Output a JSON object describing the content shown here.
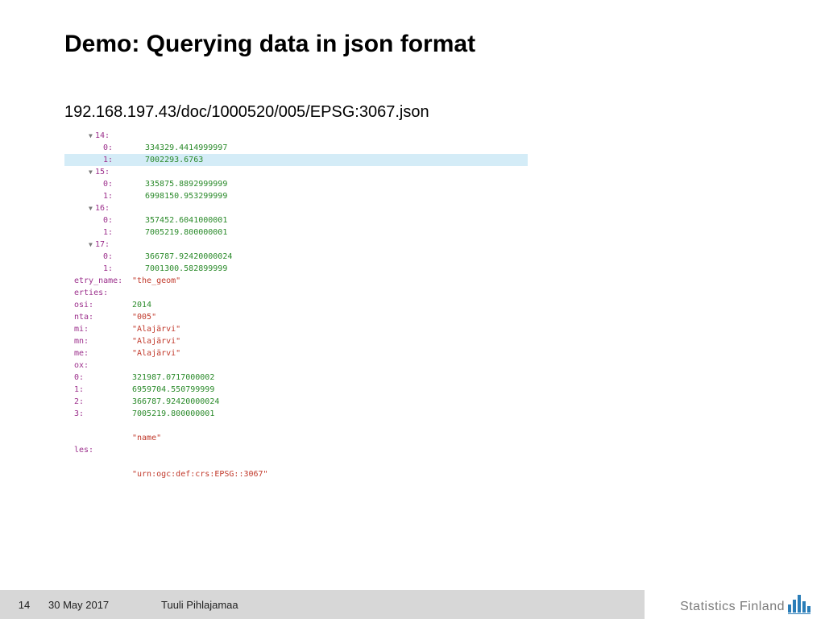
{
  "title": "Demo: Querying data in json format",
  "url": "192.168.197.43/doc/1000520/005/EPSG:3067.json",
  "json": {
    "n14": {
      "key": "14:",
      "i0": {
        "k": "0:",
        "v": "334329.4414999997"
      },
      "i1": {
        "k": "1:",
        "v": "7002293.6763"
      }
    },
    "n15": {
      "key": "15:",
      "i0": {
        "k": "0:",
        "v": "335875.8892999999"
      },
      "i1": {
        "k": "1:",
        "v": "6998150.953299999"
      }
    },
    "n16": {
      "key": "16:",
      "i0": {
        "k": "0:",
        "v": "357452.6041000001"
      },
      "i1": {
        "k": "1:",
        "v": "7005219.800000001"
      }
    },
    "n17": {
      "key": "17:",
      "i0": {
        "k": "0:",
        "v": "366787.92420000024"
      },
      "i1": {
        "k": "1:",
        "v": "7001300.582899999"
      }
    },
    "etry_name": {
      "k": "etry_name:",
      "v": "\"the_geom\""
    },
    "erties": {
      "k": "erties:"
    },
    "osi": {
      "k": "osi:",
      "v": "2014"
    },
    "nta": {
      "k": "nta:",
      "v": "\"005\""
    },
    "mi": {
      "k": "mi:",
      "v": "\"Alajärvi\""
    },
    "mn": {
      "k": "mn:",
      "v": "\"Alajärvi\""
    },
    "me": {
      "k": "me:",
      "v": "\"Alajärvi\""
    },
    "ox": {
      "k": "ox:"
    },
    "bx0": {
      "k": "0:",
      "v": "321987.0717000002"
    },
    "bx1": {
      "k": "1:",
      "v": "6959704.550799999"
    },
    "bx2": {
      "k": "2:",
      "v": "366787.92420000024"
    },
    "bx3": {
      "k": "3:",
      "v": "7005219.800000001"
    },
    "name": {
      "v": "\"name\""
    },
    "les": {
      "k": "les:"
    },
    "crs": {
      "v": "\"urn:ogc:def:crs:EPSG::3067\""
    }
  },
  "footer": {
    "page": "14",
    "date": "30 May 2017",
    "author": "Tuuli Pihlajamaa",
    "logo": "Statistics Finland"
  }
}
